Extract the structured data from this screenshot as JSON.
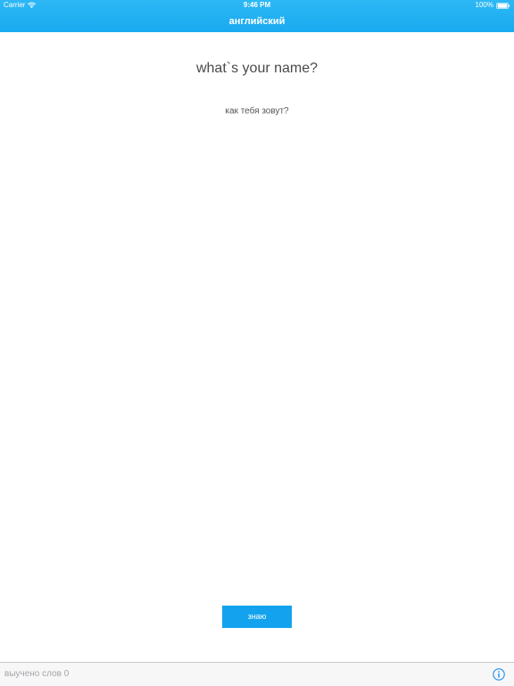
{
  "status_bar": {
    "carrier": "Carrier",
    "time": "9:46 PM",
    "battery": "100%"
  },
  "nav": {
    "title": "английский"
  },
  "card": {
    "word": "what`s your name?",
    "translation": "как тебя зовут?"
  },
  "actions": {
    "know_label": "знаю"
  },
  "footer": {
    "learned_text": "выучено слов 0"
  },
  "colors": {
    "accent": "#1aaaf0",
    "button": "#13a3ee",
    "footer_bg": "#f7f7f8",
    "info_icon": "#1a8cf0"
  },
  "icons": {
    "wifi": "wifi-icon",
    "battery": "battery-icon",
    "info": "info-icon"
  }
}
